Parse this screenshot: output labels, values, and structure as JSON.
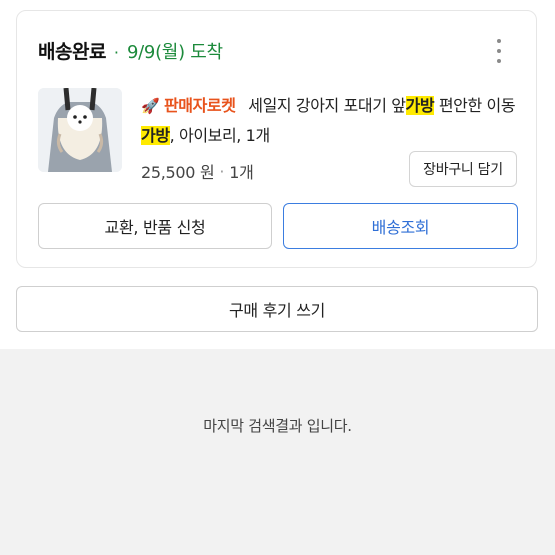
{
  "order": {
    "status": "배송완료",
    "dot": "·",
    "arrival": "9/9(월) 도착",
    "more_icon": "more-vertical-icon",
    "product": {
      "image_icon": "pet-carrier-bag-photo",
      "rocket_icon": "🚀",
      "badge": "판매자로켓",
      "title_part1": "세일지 강아지 포대기 앞",
      "highlight1": "가방",
      "title_part2": " 편안한 이동",
      "highlight2": "가방",
      "title_part3": ", 아이보리, 1개",
      "price": "25,500 원",
      "price_sep": "·",
      "quantity": "1개"
    },
    "cart_button": "장바구니 담기",
    "exchange_button": "교환, 반품 신청",
    "track_button": "배송조회"
  },
  "review_button": "구매 후기 쓰기",
  "end_message": "마지막 검색결과 입니다.",
  "colors": {
    "status_green": "#1c8a3b",
    "badge_orange": "#e8531c",
    "highlight_yellow": "#ffea00",
    "track_blue": "#2f6fd6",
    "footer_gray": "#f2f2f2"
  }
}
